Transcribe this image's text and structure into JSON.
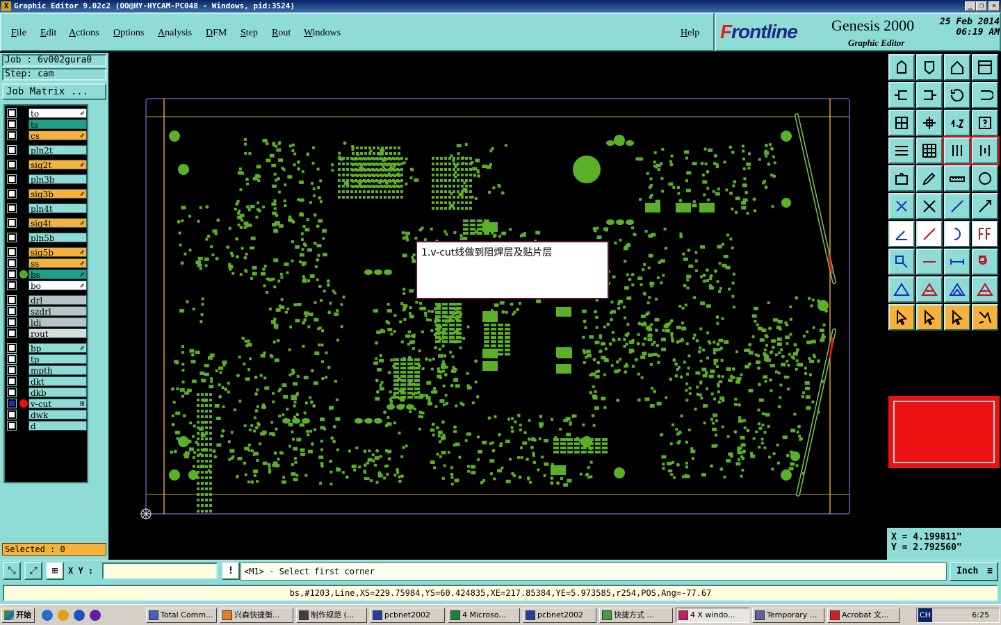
{
  "window": {
    "title": "Graphic Editor 9.02c2 (OO@HY-HYCAM-PC048 - Windows, pid:3524)"
  },
  "menu": [
    "File",
    "Edit",
    "Actions",
    "Options",
    "Analysis",
    "DFM",
    "Step",
    "Rout",
    "Windows"
  ],
  "help": "Help",
  "brand": {
    "logo_a": "F",
    "logo_b": "rontline",
    "product": "Genesis 2000",
    "subtitle": "Graphic Editor",
    "date": "25 Feb 2014",
    "time": "06:19 AM"
  },
  "job": {
    "job": "Job : 6v002gura0",
    "step": "Step: cam",
    "matrix_button": "Job Matrix ..."
  },
  "layers": [
    {
      "name": "to",
      "color": "#ffffff",
      "dot": "",
      "arrow": "⇙"
    },
    {
      "name": "ts",
      "color": "#1fa08a",
      "dot": "",
      "arrow": ""
    },
    {
      "name": "cs",
      "color": "#f7b23a",
      "dot": "",
      "arrow": "⇙"
    },
    {
      "name": "pln2t",
      "color": "#8fdbd6",
      "dot": "",
      "arrow": ""
    },
    {
      "name": "sig2t",
      "color": "#f7b23a",
      "dot": "",
      "arrow": "⇙"
    },
    {
      "name": "pln3b",
      "color": "#8fdbd6",
      "dot": "",
      "arrow": ""
    },
    {
      "name": "sig3b",
      "color": "#f7b23a",
      "dot": "",
      "arrow": "⇙"
    },
    {
      "name": "pln4t",
      "color": "#8fdbd6",
      "dot": "",
      "arrow": ""
    },
    {
      "name": "sig4t",
      "color": "#f7b23a",
      "dot": "",
      "arrow": "⇙"
    },
    {
      "name": "pln5b",
      "color": "#8fdbd6",
      "dot": "",
      "arrow": ""
    },
    {
      "name": "sig5b",
      "color": "#f7b23a",
      "dot": "",
      "arrow": "⇙"
    },
    {
      "name": "ss",
      "color": "#f7b23a",
      "dot": "",
      "arrow": "⇙"
    },
    {
      "name": "bs",
      "color": "#1fa08a",
      "dot": "#5aa82a",
      "arrow": "⇙"
    },
    {
      "name": "bo",
      "color": "#ffffff",
      "dot": "",
      "arrow": "⇙"
    },
    {
      "name": "drl",
      "color": "#b8c4c8",
      "dot": "",
      "arrow": ""
    },
    {
      "name": "szdrl",
      "color": "#b8c4c8",
      "dot": "",
      "arrow": ""
    },
    {
      "name": "ldi",
      "color": "#b8c4c8",
      "dot": "",
      "arrow": ""
    },
    {
      "name": "rout",
      "color": "#d8dcdc",
      "dot": "",
      "arrow": ""
    },
    {
      "name": "bp",
      "color": "#8fdbd6",
      "dot": "",
      "arrow": "⇙"
    },
    {
      "name": "tp",
      "color": "#8fdbd6",
      "dot": "",
      "arrow": ""
    },
    {
      "name": "mpth",
      "color": "#8fdbd6",
      "dot": "",
      "arrow": ""
    },
    {
      "name": "dkt",
      "color": "#8fdbd6",
      "dot": "",
      "arrow": ""
    },
    {
      "name": "dkb",
      "color": "#8fdbd6",
      "dot": "",
      "arrow": ""
    },
    {
      "name": "v-cut",
      "color": "#8fdbd6",
      "dot": "#e81010",
      "arrow": "⊞"
    },
    {
      "name": "dwk",
      "color": "#8fdbd6",
      "dot": "",
      "arrow": ""
    },
    {
      "name": "d",
      "color": "#8fdbd6",
      "dot": "",
      "arrow": ""
    }
  ],
  "selected": "Selected : 0",
  "note": "1.v-cut线做到阻焊层及贴片层",
  "coords": {
    "x": "X = 4.199811\"",
    "y": "Y = 2.792560\""
  },
  "cmd": {
    "xy_label": "X Y :",
    "xy_value": "",
    "prompt": "<M1> - Select first corner",
    "unit": "Inch"
  },
  "status": "bs,#1203,Line,XS=229.75984,YS=60.424835,XE=217.85384,YE=5.973585,r254,POS,Ang=-77.67",
  "taskbar": {
    "start": "开始",
    "tasks": [
      "Total Comm...",
      "兴森快捷衡...",
      "制作规范 (...",
      "pcbnet2002",
      "4 Microso...",
      "pcbnet2002",
      "快捷方式 ...",
      "4 X windo...",
      "Temporary ...",
      "Acrobat 文..."
    ],
    "clock": "6:25",
    "tray_ch": "CH"
  }
}
